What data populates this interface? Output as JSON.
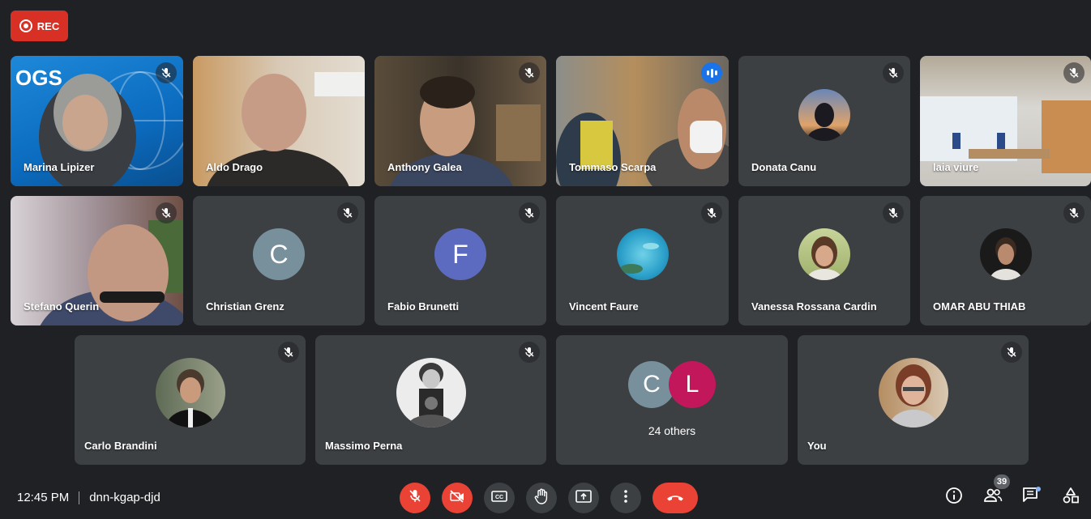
{
  "recording": {
    "label": "REC"
  },
  "participants": {
    "marina": {
      "name": "Marina Lipizer",
      "logo_text": "OGS"
    },
    "aldo": {
      "name": "Aldo Drago"
    },
    "anthony": {
      "name": "Anthony Galea"
    },
    "tommaso": {
      "name": "Tommaso Scarpa"
    },
    "donata": {
      "name": "Donata Canu"
    },
    "laia": {
      "name": "laia viure"
    },
    "stefano": {
      "name": "Stefano Querin"
    },
    "christian": {
      "name": "Christian Grenz",
      "initial": "C"
    },
    "fabio": {
      "name": "Fabio Brunetti",
      "initial": "F"
    },
    "vincent": {
      "name": "Vincent Faure"
    },
    "vanessa": {
      "name": "Vanessa Rossana Cardin"
    },
    "omar": {
      "name": "OMAR ABU THIAB"
    },
    "carlo": {
      "name": "Carlo Brandini"
    },
    "massimo": {
      "name": "Massimo Perna"
    },
    "you": {
      "name": "You"
    }
  },
  "others": {
    "initial_1": "C",
    "initial_2": "L",
    "label": "24 others"
  },
  "meeting": {
    "time": "12:45 PM",
    "code": "dnn-kgap-djd"
  },
  "participants_count": "39",
  "colors": {
    "red": "#ea4335",
    "tile": "#3c4043",
    "background": "#202124",
    "speaking_border": "#8ab4f8"
  },
  "icons": [
    "mic-off-icon",
    "camera-off-icon",
    "captions-icon",
    "raise-hand-icon",
    "present-icon",
    "more-options-icon",
    "end-call-icon",
    "info-icon",
    "people-icon",
    "chat-icon",
    "activities-icon"
  ]
}
